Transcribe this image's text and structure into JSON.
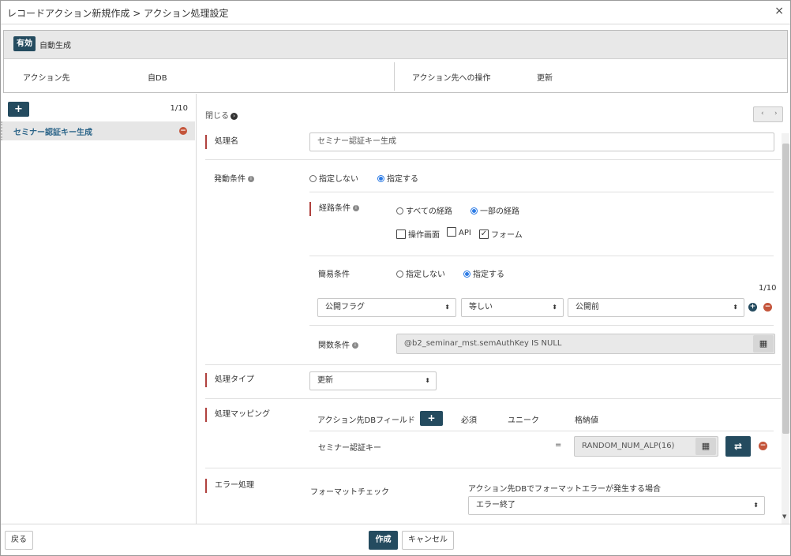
{
  "dialog": {
    "title": "レコードアクション新規作成 > アクション処理設定",
    "close_icon": "×"
  },
  "summary": {
    "active_badge": "有効",
    "auto_generated": "自動生成",
    "target_label": "アクション先",
    "target_value": "自DB",
    "operation_label": "アクション先への操作",
    "operation_value": "更新"
  },
  "sidebar": {
    "add_icon": "+",
    "page_count": "1/10",
    "items": [
      {
        "label": "セミナー認証キー生成"
      }
    ]
  },
  "main": {
    "close_link": "閉じる",
    "process_name": {
      "label": "処理名",
      "value": "セミナー認証キー生成"
    },
    "trigger": {
      "label": "発動条件",
      "options": [
        "指定しない",
        "指定する"
      ],
      "selected": "指定する",
      "route": {
        "label": "経路条件",
        "options": [
          "すべての経路",
          "一部の経路"
        ],
        "selected": "一部の経路",
        "checks": [
          {
            "label": "操作画面",
            "checked": false
          },
          {
            "label": "API",
            "checked": false
          },
          {
            "label": "フォーム",
            "checked": true
          }
        ]
      },
      "simple": {
        "label": "簡易条件",
        "options": [
          "指定しない",
          "指定する"
        ],
        "selected": "指定する",
        "count": "1/10",
        "field": "公開フラグ",
        "operator": "等しい",
        "value": "公開前"
      },
      "function": {
        "label": "関数条件",
        "value": "@b2_seminar_mst.semAuthKey IS NULL"
      }
    },
    "process_type": {
      "label": "処理タイプ",
      "value": "更新"
    },
    "mapping": {
      "label": "処理マッピング",
      "headers": [
        "アクション先DBフィールド",
        "必須",
        "ユニーク",
        "格納値"
      ],
      "rows": [
        {
          "field": "セミナー認証キー",
          "eq": "=",
          "value": "RANDOM_NUM_ALP(16)"
        }
      ]
    },
    "error": {
      "label": "エラー処理",
      "format_check": "フォーマットチェック",
      "desc": "アクション先DBでフォーマットエラーが発生する場合",
      "value": "エラー終了"
    }
  },
  "footer": {
    "back": "戻る",
    "create": "作成",
    "cancel": "キャンセル"
  },
  "colors": {
    "primary": "#244b5f",
    "danger": "#c4553b",
    "radio": "#2c7be5",
    "section_marker": "#b0413e"
  },
  "icons": [
    "close-icon",
    "plus-icon",
    "minus-circle-icon",
    "info-icon",
    "calculator-icon",
    "swap-icon",
    "chevron-right-icon",
    "caret-updown-icon"
  ]
}
